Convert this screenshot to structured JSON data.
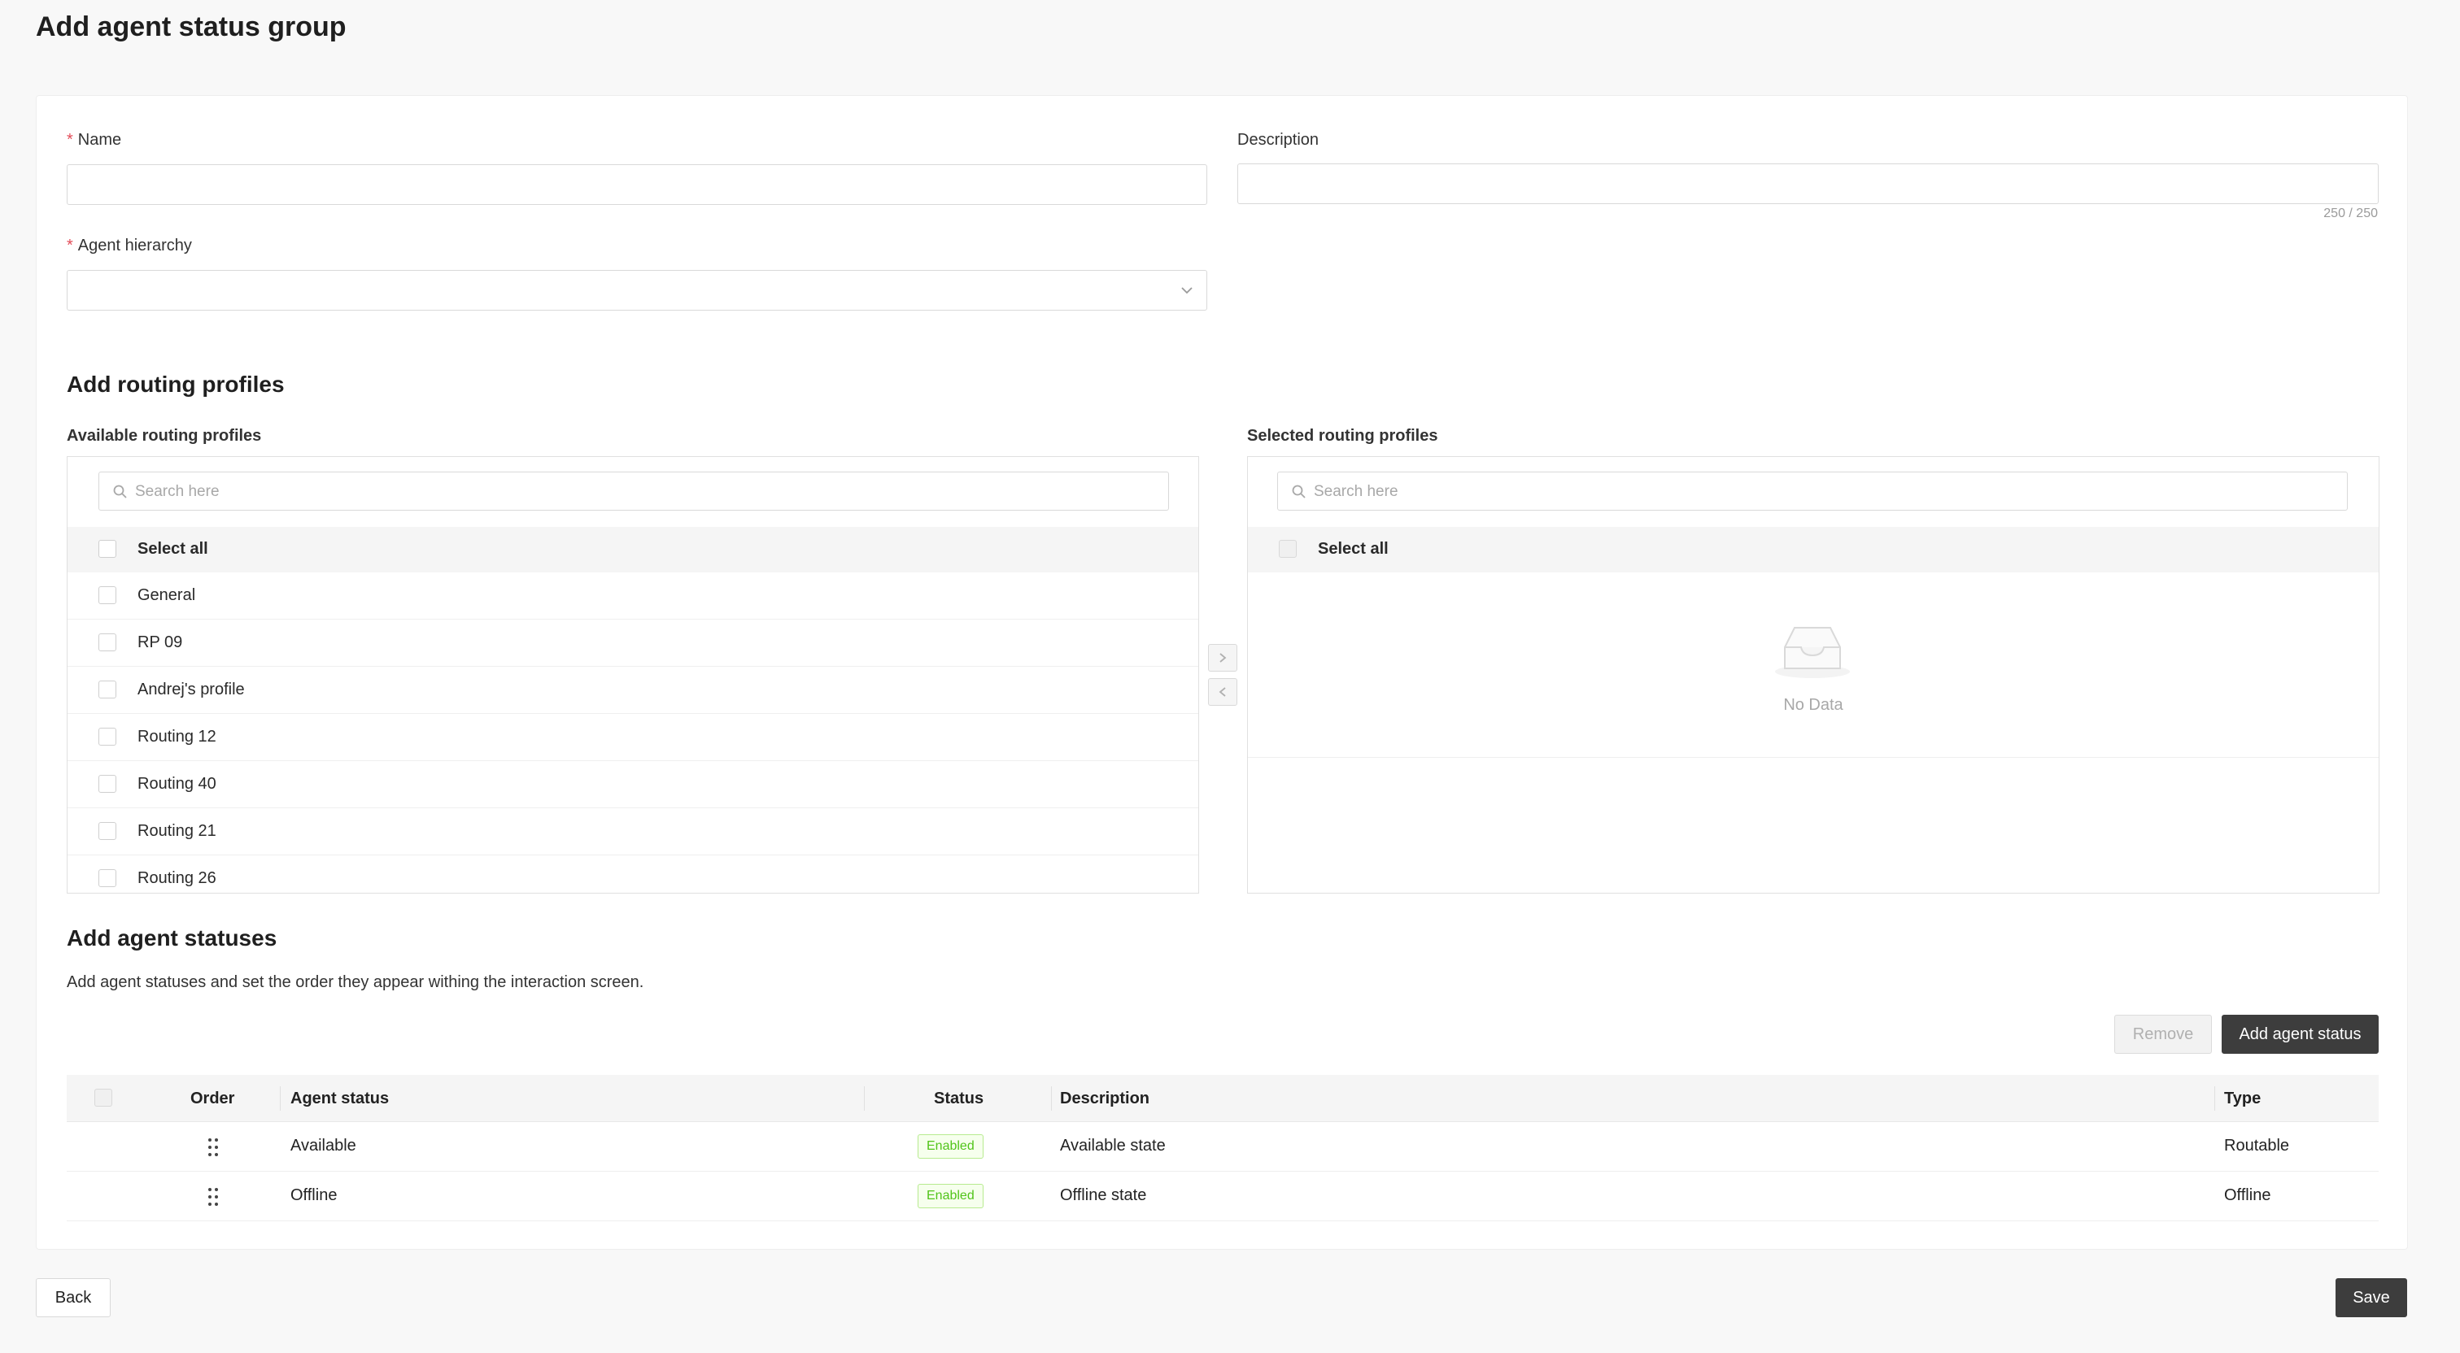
{
  "page": {
    "title": "Add agent status group"
  },
  "form": {
    "name_label": "Name",
    "description_label": "Description",
    "description_counter": "250 / 250",
    "hierarchy_label": "Agent hierarchy"
  },
  "routing": {
    "title": "Add routing profiles",
    "available_label": "Available routing profiles",
    "selected_label": "Selected routing profiles",
    "search_placeholder": "Search here",
    "select_all": "Select all",
    "available_items": [
      "General",
      "RP 09",
      "Andrej's profile",
      "Routing 12",
      "Routing 40",
      "Routing 21",
      "Routing 26"
    ],
    "no_data": "No Data"
  },
  "statuses": {
    "title": "Add agent statuses",
    "description": "Add agent statuses and set the order they appear withing the interaction screen.",
    "remove_label": "Remove",
    "add_label": "Add agent status",
    "columns": {
      "order": "Order",
      "agent_status": "Agent status",
      "status": "Status",
      "description": "Description",
      "type": "Type"
    },
    "rows": [
      {
        "agent_status": "Available",
        "status": "Enabled",
        "description": "Available state",
        "type": "Routable"
      },
      {
        "agent_status": "Offline",
        "status": "Enabled",
        "description": "Offline state",
        "type": "Offline"
      }
    ]
  },
  "footer": {
    "back_label": "Back",
    "save_label": "Save"
  },
  "colors": {
    "accent_dark": "#3d3d3d",
    "required": "#e34d59",
    "enabled_green": "#52c41a"
  }
}
